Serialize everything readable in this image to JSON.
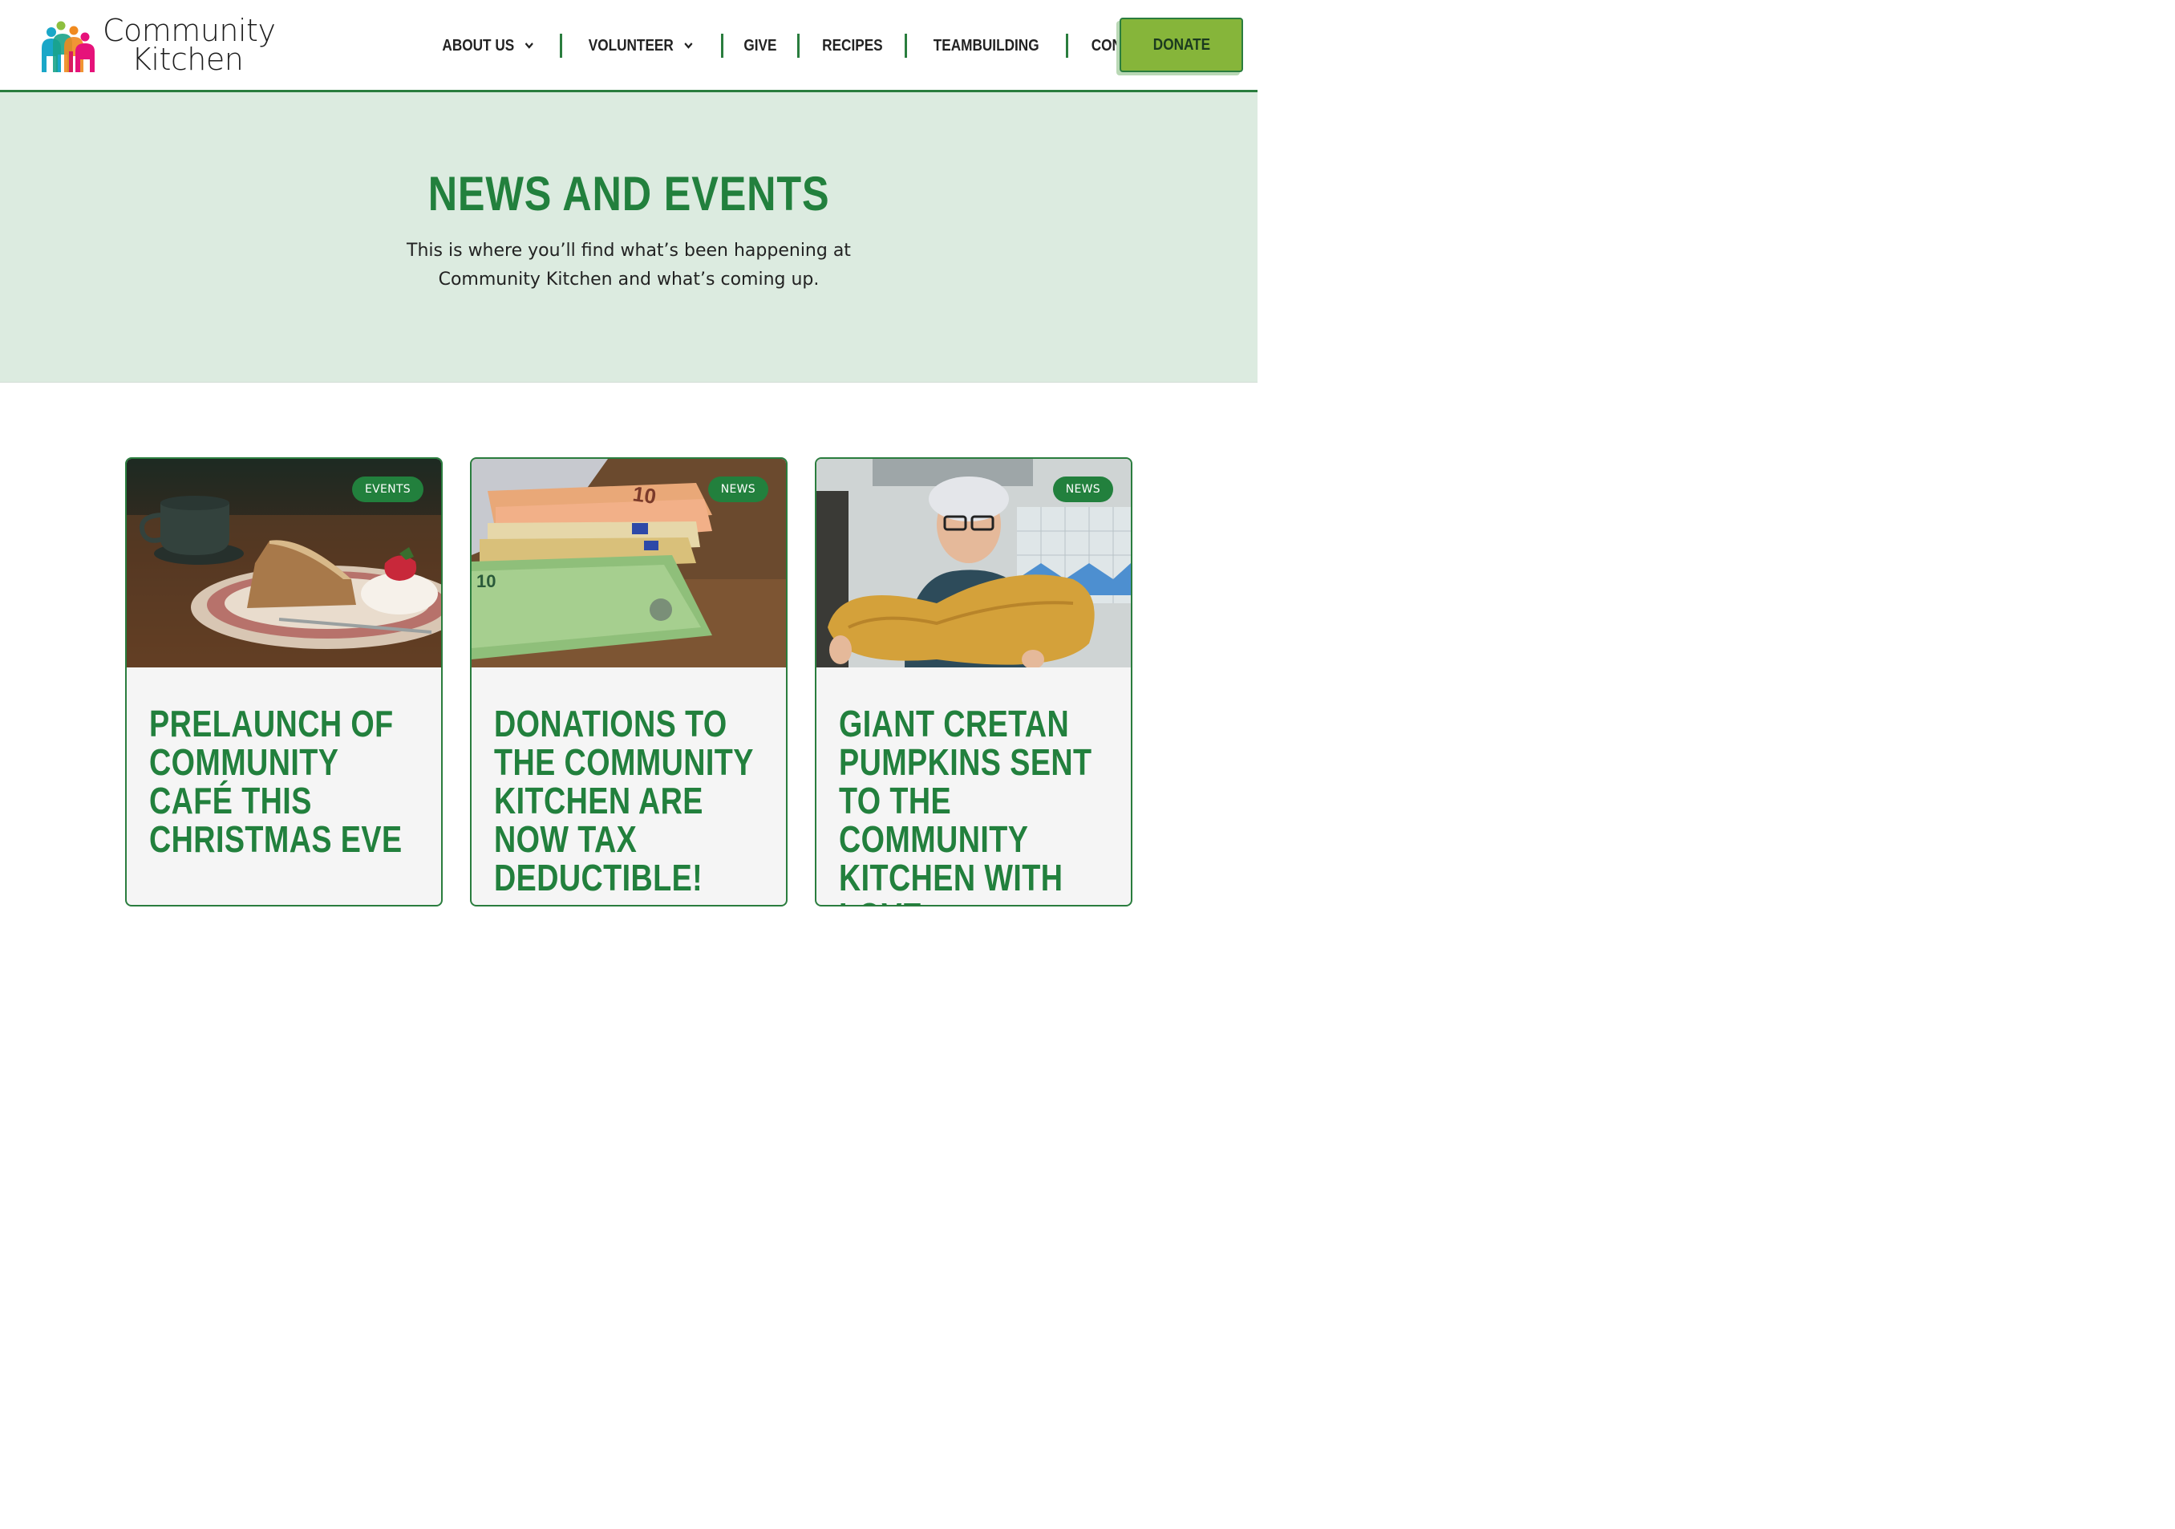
{
  "brand": {
    "line1": "Community",
    "line2": "Kitchen",
    "colors": [
      "#8dbf3f",
      "#1aa7c8",
      "#f08a1f",
      "#e6127a",
      "#19a38a",
      "#d81b60"
    ]
  },
  "nav": {
    "items": [
      {
        "label": "ABOUT US",
        "has_dropdown": true
      },
      {
        "label": "VOLUNTEER",
        "has_dropdown": true
      },
      {
        "label": "GIVE",
        "has_dropdown": false
      },
      {
        "label": "RECIPES",
        "has_dropdown": false
      },
      {
        "label": "TEAMBUILDING",
        "has_dropdown": false
      },
      {
        "label": "CONTACT",
        "has_dropdown": false
      }
    ],
    "donate_label": "DONATE"
  },
  "hero": {
    "title": "NEWS AND EVENTS",
    "subtitle": "This is where you’ll find what’s been happening at Community Kitchen and what’s coming up."
  },
  "cards": [
    {
      "badge": "EVENTS",
      "title": "PRELAUNCH OF COMMUNITY CAFÉ THIS CHRISTMAS EVE",
      "image": "cake-and-coffee"
    },
    {
      "badge": "NEWS",
      "title": "DONATIONS TO THE COMMUNITY KITCHEN ARE NOW TAX DEDUCTIBLE!",
      "image": "euro-banknotes"
    },
    {
      "badge": "NEWS",
      "title": "GIANT CRETAN PUMPKINS SENT TO THE COMMUNITY KITCHEN WITH LOVE",
      "image": "woman-holding-pumpkin"
    }
  ],
  "theme": {
    "primary_green": "#22803d",
    "donate_green": "#86b53a",
    "hero_bg": "#dcebe0"
  }
}
